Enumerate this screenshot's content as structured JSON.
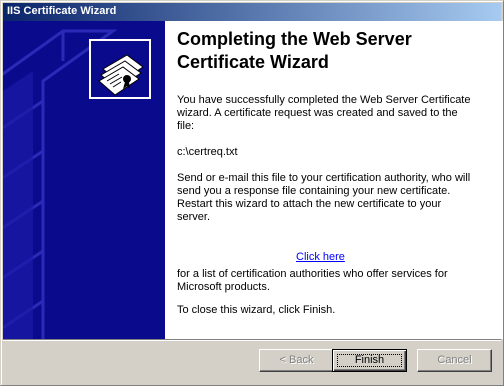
{
  "window": {
    "title": "IIS Certificate Wizard"
  },
  "sidebar": {
    "icon": "certificate-icon",
    "background": "#0a0a8c"
  },
  "content": {
    "heading": "Completing the Web Server Certificate Wizard",
    "para1": "You have successfully completed the Web Server Certificate wizard. A certificate request was created and saved to the file:",
    "file_path": "c:\\certreq.txt",
    "para2": "Send or e-mail this file to your certification authority, who will send you a response file containing your new certificate. Restart this wizard to attach the new certificate to your server.",
    "link_text": "Click here",
    "para3": "for a list of certification authorities who offer services for Microsoft products.",
    "para4": "To close this wizard, click Finish."
  },
  "buttons": {
    "back": "< Back",
    "finish": "Finish",
    "cancel": "Cancel"
  }
}
